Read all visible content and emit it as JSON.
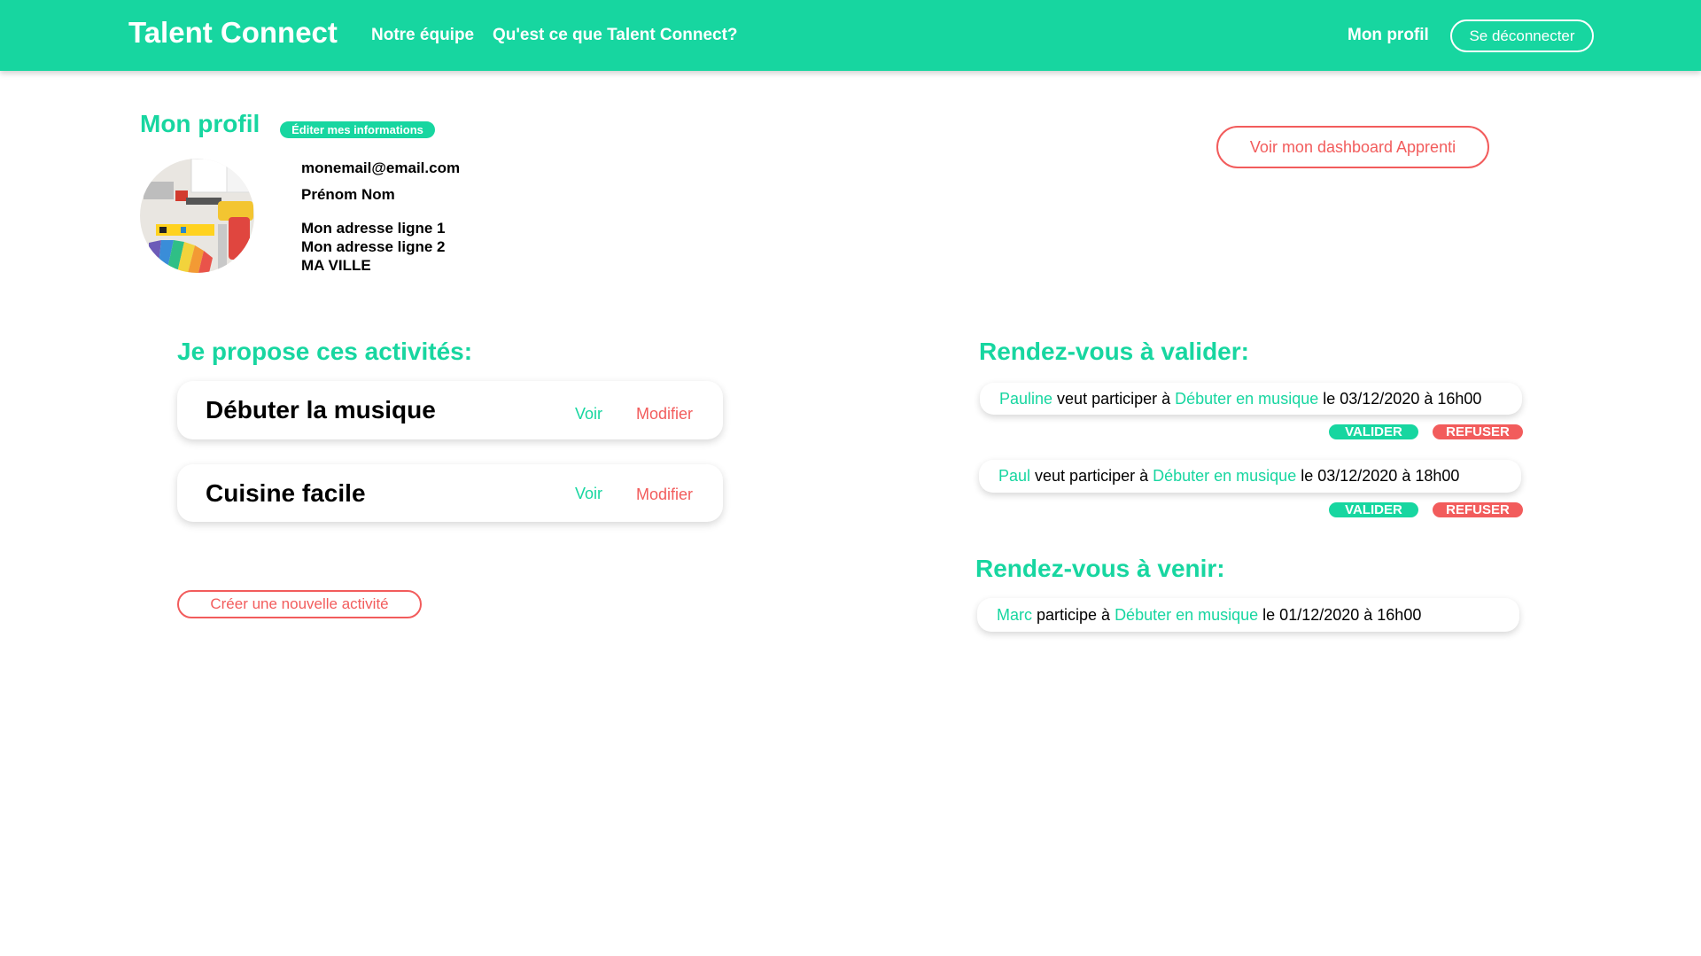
{
  "nav": {
    "brand": "Talent Connect",
    "links": [
      "Notre équipe",
      "Qu'est ce que Talent Connect?"
    ],
    "profile": "Mon profil",
    "logout": "Se déconnecter"
  },
  "profile": {
    "title": "Mon profil",
    "edit_label": "Éditer mes informations",
    "dashboard_button": "Voir mon dashboard Apprenti",
    "email": "monemail@email.com",
    "name": "Prénom Nom",
    "address_line1": "Mon adresse ligne 1",
    "address_line2": "Mon adresse ligne 2",
    "city": "MA VILLE"
  },
  "activities": {
    "title": "Je propose ces activités:",
    "items": [
      {
        "name": "Débuter la musique",
        "view": "Voir",
        "edit": "Modifier"
      },
      {
        "name": "Cuisine facile",
        "view": "Voir",
        "edit": "Modifier"
      }
    ],
    "create_button": "Créer une nouvelle activité"
  },
  "pending": {
    "title": "Rendez-vous à valider:",
    "items": [
      {
        "person": "Pauline",
        "verb": " veut participer à ",
        "activity": "Débuter en musique",
        "when": " le 03/12/2020 à 16h00",
        "accept": "VALIDER",
        "reject": "REFUSER"
      },
      {
        "person": "Paul",
        "verb": " veut participer à ",
        "activity": "Débuter en musique",
        "when": " le 03/12/2020 à 18h00",
        "accept": "VALIDER",
        "reject": "REFUSER"
      }
    ]
  },
  "upcoming": {
    "title": "Rendez-vous à venir:",
    "items": [
      {
        "person": "Marc",
        "verb": " participe à ",
        "activity": "Débuter en musique",
        "when": " le 01/12/2020 à 16h00"
      }
    ]
  },
  "colors": {
    "accent": "#17d6a0",
    "danger": "#f25c5c"
  }
}
